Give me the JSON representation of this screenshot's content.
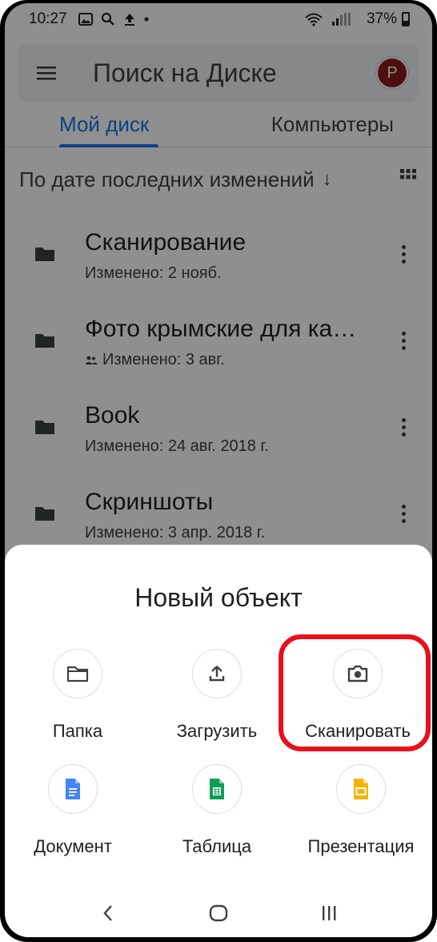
{
  "status_bar": {
    "time": "10:27",
    "battery_percent": "37%",
    "icons": [
      "gallery-icon",
      "search-icon",
      "upload-icon",
      "dot-icon",
      "wifi-icon",
      "signal-icon",
      "battery-icon"
    ]
  },
  "search_bar": {
    "title": "Поиск на Диске",
    "avatar_letter": "Р"
  },
  "tabs": [
    {
      "label": "Мой диск",
      "active": true
    },
    {
      "label": "Компьютеры",
      "active": false
    }
  ],
  "sort": {
    "label": "По дате последних изменений",
    "arrow": "↓"
  },
  "files": [
    {
      "name": "Сканирование",
      "meta": "Изменено: 2 нояб.",
      "shared": false
    },
    {
      "name": "Фото крымские для ка…",
      "meta": "Изменено: 3 авг.",
      "shared": true
    },
    {
      "name": "Book",
      "meta": "Изменено: 24 авг. 2018 г.",
      "shared": false
    },
    {
      "name": "Скриншоты",
      "meta": "Изменено: 3 апр. 2018 г.",
      "shared": false
    }
  ],
  "sheet": {
    "title": "Новый объект",
    "options": [
      {
        "label": "Папка",
        "icon": "folder-icon"
      },
      {
        "label": "Загрузить",
        "icon": "upload-icon"
      },
      {
        "label": "Сканировать",
        "icon": "camera-icon",
        "highlighted": true
      },
      {
        "label": "Документ",
        "icon": "google-docs-icon"
      },
      {
        "label": "Таблица",
        "icon": "google-sheets-icon"
      },
      {
        "label": "Презентация",
        "icon": "google-slides-icon"
      }
    ]
  },
  "colors": {
    "accent": "#1a73e8",
    "highlight_ring": "#e8101b",
    "docs": "#4285f4",
    "sheets": "#0f9d58",
    "slides": "#f4b400",
    "avatar": "#8e1b1b"
  },
  "nav_bar": [
    "back-icon",
    "home-icon",
    "recents-icon"
  ]
}
